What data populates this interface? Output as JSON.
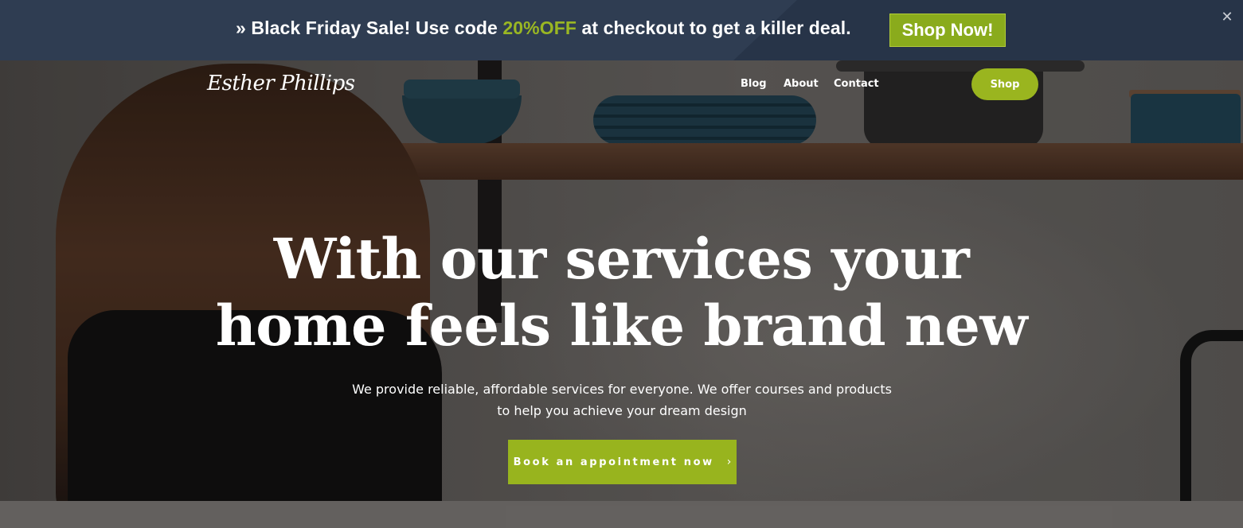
{
  "promo": {
    "prefix": "» Black Friday Sale! Use code ",
    "code": "20%OFF",
    "suffix": " at checkout to get a killer deal.",
    "button_label": "Shop Now!",
    "close_icon": "close-icon",
    "close_glyph": "✕",
    "accent_color": "#9ab723"
  },
  "header": {
    "logo": "Esther Phillips",
    "nav": [
      {
        "label": "Blog"
      },
      {
        "label": "About"
      },
      {
        "label": "Contact"
      }
    ],
    "shop_label": "Shop"
  },
  "hero": {
    "headline_line1": "With our services your",
    "headline_line2": "home feels like brand new",
    "subtext": "We provide reliable, affordable services for everyone. We offer courses and products to help you achieve your dream design",
    "cta_label": "Book an appointment now",
    "cta_icon": "chevron-right-icon",
    "cta_glyph": "›"
  },
  "colors": {
    "promo_bg": "#2f3d52",
    "brand_green": "#98b41e"
  }
}
